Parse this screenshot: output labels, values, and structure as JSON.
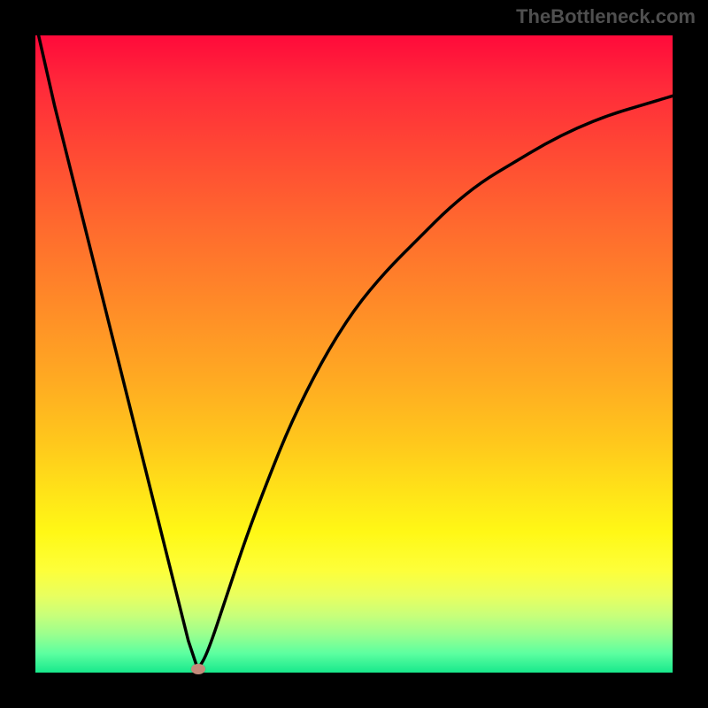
{
  "watermark": "TheBottleneck.com",
  "chart_data": {
    "type": "line",
    "title": "",
    "xlabel": "",
    "ylabel": "",
    "xlim": [
      0,
      100
    ],
    "ylim": [
      0,
      100
    ],
    "grid": false,
    "legend": false,
    "background_gradient": {
      "direction": "vertical",
      "stops": [
        {
          "pos": 0.0,
          "color": "#ff0a3a"
        },
        {
          "pos": 0.5,
          "color": "#ffaa22"
        },
        {
          "pos": 0.8,
          "color": "#fdff3a"
        },
        {
          "pos": 1.0,
          "color": "#18e88c"
        }
      ]
    },
    "series": [
      {
        "name": "bottleneck-curve",
        "color": "#000000",
        "x": [
          0.5,
          3,
          6,
          9,
          12,
          15,
          18,
          21,
          24,
          25.5,
          27,
          30,
          33,
          36,
          40,
          45,
          50,
          55,
          60,
          65,
          70,
          75,
          80,
          85,
          90,
          95,
          100
        ],
        "y": [
          100,
          89,
          77,
          65,
          53,
          41,
          29,
          17,
          5,
          0.5,
          3,
          12,
          21,
          29,
          39,
          49,
          57,
          63,
          68,
          73,
          77,
          80,
          83,
          85.5,
          87.5,
          89,
          90.5
        ]
      }
    ],
    "marker": {
      "name": "optimal-point",
      "x": 25.5,
      "y": 0.5,
      "color": "#c58a7a"
    }
  }
}
